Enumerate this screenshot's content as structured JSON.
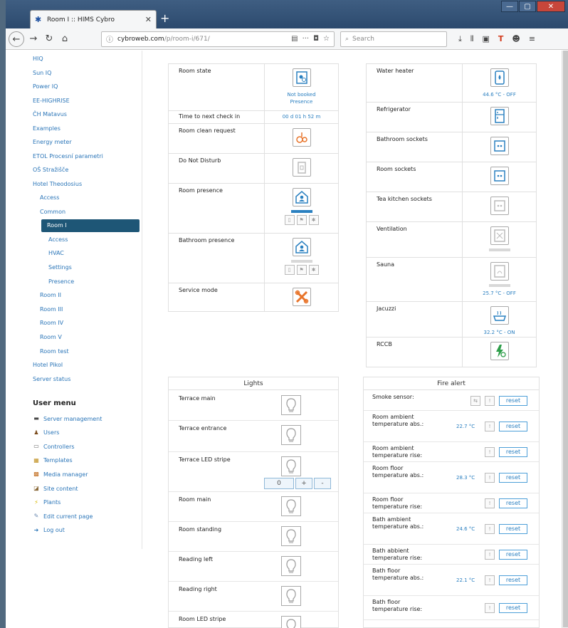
{
  "browser": {
    "tab_title": "Room I :: HIMS Cybro",
    "url_host": "cybroweb.com",
    "url_path": "/p/room-i/671/",
    "search_placeholder": "Search"
  },
  "sidebar": {
    "items": [
      {
        "label": "HIQ"
      },
      {
        "label": "Sun IQ"
      },
      {
        "label": "Power IQ"
      },
      {
        "label": "EE-HIGHRISE"
      },
      {
        "label": "ČH Matavus"
      },
      {
        "label": "Examples"
      },
      {
        "label": "Energy meter"
      },
      {
        "label": "ETOL Procesní parametri"
      },
      {
        "label": "OŠ Stražišče"
      },
      {
        "label": "Hotel Theodosius"
      },
      {
        "label": "Access"
      },
      {
        "label": "Common"
      },
      {
        "label": "Room I"
      },
      {
        "label": "Access"
      },
      {
        "label": "HVAC"
      },
      {
        "label": "Settings"
      },
      {
        "label": "Presence"
      },
      {
        "label": "Room II"
      },
      {
        "label": "Room III"
      },
      {
        "label": "Room IV"
      },
      {
        "label": "Room V"
      },
      {
        "label": "Room test"
      },
      {
        "label": "Hotel Pikol"
      },
      {
        "label": "Server status"
      }
    ],
    "user_menu_title": "User menu",
    "user_menu": [
      {
        "label": "Server management",
        "icon": "server-icon"
      },
      {
        "label": "Users",
        "icon": "users-icon"
      },
      {
        "label": "Controllers",
        "icon": "controller-icon"
      },
      {
        "label": "Templates",
        "icon": "template-icon"
      },
      {
        "label": "Media manager",
        "icon": "media-icon"
      },
      {
        "label": "Site content",
        "icon": "content-icon"
      },
      {
        "label": "Plants",
        "icon": "plant-icon"
      },
      {
        "label": "Edit current page",
        "icon": "edit-icon"
      },
      {
        "label": "Log out",
        "icon": "logout-icon"
      }
    ]
  },
  "room": {
    "state_label": "Room state",
    "state_value": "Not booked",
    "state_value2": "Presence",
    "checkin_label": "Time to next check in",
    "checkin_value": "00 d 01 h 52 m",
    "clean_label": "Room clean request",
    "dnd_label": "Do Not Disturb",
    "presence_label": "Room presence",
    "bath_presence_label": "Bathroom presence",
    "service_label": "Service mode"
  },
  "appliances": {
    "water_heater_label": "Water heater",
    "water_heater_value": "44.6 °C - OFF",
    "fridge_label": "Refrigerator",
    "bath_sockets_label": "Bathroom sockets",
    "room_sockets_label": "Room sockets",
    "tea_sockets_label": "Tea kitchen sockets",
    "ventilation_label": "Ventilation",
    "sauna_label": "Sauna",
    "sauna_value": "25.7 °C - OFF",
    "jacuzzi_label": "Jacuzzi",
    "jacuzzi_value": "32.2 °C - ON",
    "rccb_label": "RCCB"
  },
  "lights": {
    "title": "Lights",
    "rows": [
      {
        "label": "Terrace main"
      },
      {
        "label": "Terrace entrance"
      },
      {
        "label": "Terrace LED stripe"
      },
      {
        "label": "Room main"
      },
      {
        "label": "Room standing"
      },
      {
        "label": "Reading left"
      },
      {
        "label": "Reading right"
      },
      {
        "label": "Room LED stripe"
      }
    ],
    "stepper_value": "0",
    "plus": "+",
    "minus": "-"
  },
  "fire": {
    "title": "Fire alert",
    "reset_label": "reset",
    "rows": [
      {
        "label": "Smoke sensor:",
        "temp": ""
      },
      {
        "label": "Room ambient temperature abs.:",
        "temp": "22.7 °C"
      },
      {
        "label": "Room ambient temperature rise:",
        "temp": ""
      },
      {
        "label": "Room floor temperature abs.:",
        "temp": "28.3 °C"
      },
      {
        "label": "Room floor temperature rise:",
        "temp": ""
      },
      {
        "label": "Bath ambient temperature abs.:",
        "temp": "24.6 °C"
      },
      {
        "label": "Bath abbient temperature rise:",
        "temp": ""
      },
      {
        "label": "Bath floor temperature abs.:",
        "temp": "22.1 °C"
      },
      {
        "label": "Bath floor temperature rise:",
        "temp": ""
      }
    ]
  },
  "colors": {
    "accent": "#2a80c0",
    "active_nav": "#1e5676",
    "orange_icon": "#e8742a",
    "green_icon": "#2e9e4a"
  }
}
